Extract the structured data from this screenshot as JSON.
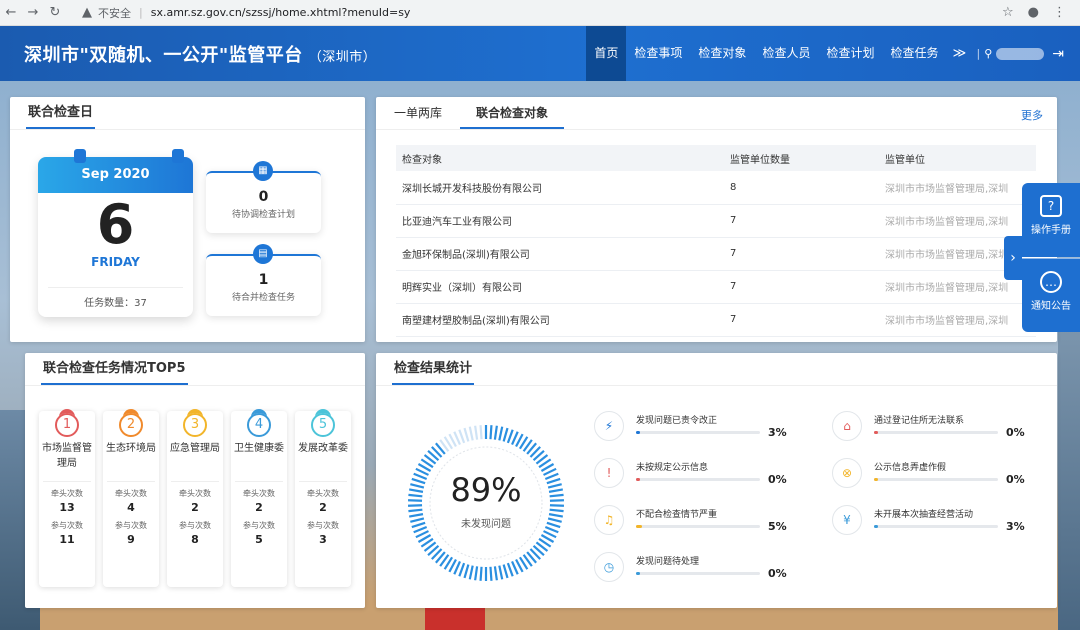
{
  "browser": {
    "insecure": "不安全",
    "url": "sx.amr.sz.gov.cn/szssj/home.xhtml?menuId=sy"
  },
  "header": {
    "title": "深圳市\"双随机、一公开\"监管平台",
    "subtitle": "（深圳市）",
    "nav": [
      "首页",
      "检查事项",
      "检查对象",
      "检查人员",
      "检查计划",
      "检查任务"
    ]
  },
  "calendar": {
    "panel_title": "联合检查日",
    "month": "Sep 2020",
    "day": "6",
    "weekday": "FRIDAY",
    "task_label": "任务数量：",
    "task_count": "37",
    "stats": [
      {
        "value": "0",
        "label": "待协调检查计划"
      },
      {
        "value": "1",
        "label": "待合并检查任务"
      }
    ]
  },
  "objects": {
    "tabs": [
      "一单两库",
      "联合检查对象"
    ],
    "more": "更多",
    "columns": [
      "检查对象",
      "监管单位数量",
      "监管单位"
    ],
    "rows": [
      [
        "深圳长城开发科技股份有限公司",
        "8",
        "深圳市市场监督管理局,深圳"
      ],
      [
        "比亚迪汽车工业有限公司",
        "7",
        "深圳市市场监督管理局,深圳"
      ],
      [
        "金旭环保制品(深圳)有限公司",
        "7",
        "深圳市市场监督管理局,深圳"
      ],
      [
        "明辉实业（深圳）有限公司",
        "7",
        "深圳市市场监督管理局,深圳"
      ],
      [
        "南塑建材塑胶制品(深圳)有限公司",
        "7",
        "深圳市市场监督管理局,深圳"
      ]
    ]
  },
  "top5": {
    "panel_title": "联合检查任务情况TOP5",
    "lead_label": "牵头次数",
    "join_label": "参与次数",
    "items": [
      {
        "rank": "1",
        "name": "市场监督管理局",
        "lead": "13",
        "join": "11",
        "color": "#e25b5b"
      },
      {
        "rank": "2",
        "name": "生态环境局",
        "lead": "4",
        "join": "9",
        "color": "#f08a2c"
      },
      {
        "rank": "3",
        "name": "应急管理局",
        "lead": "2",
        "join": "8",
        "color": "#f2b52a"
      },
      {
        "rank": "4",
        "name": "卫生健康委",
        "lead": "2",
        "join": "5",
        "color": "#3a9ad9"
      },
      {
        "rank": "5",
        "name": "发展改革委",
        "lead": "2",
        "join": "3",
        "color": "#4cc4d9"
      }
    ]
  },
  "results": {
    "panel_title": "检查结果统计",
    "gauge_value": "89%",
    "gauge_label": "未发现问题",
    "gauge_fraction": 0.89,
    "items": [
      {
        "label": "发现问题已责令改正",
        "value": "3%",
        "fraction": 0.03,
        "icon": "lightning-icon",
        "glyph": "⚡",
        "color": "#1e76d6"
      },
      {
        "label": "通过登记住所无法联系",
        "value": "0%",
        "fraction": 0.0,
        "icon": "home-icon",
        "glyph": "⌂",
        "color": "#e25b5b"
      },
      {
        "label": "未按规定公示信息",
        "value": "0%",
        "fraction": 0.0,
        "icon": "alert-icon",
        "glyph": "!",
        "color": "#e25b5b"
      },
      {
        "label": "公示信息弄虚作假",
        "value": "0%",
        "fraction": 0.0,
        "icon": "cancel-icon",
        "glyph": "⊗",
        "color": "#f2b52a"
      },
      {
        "label": "不配合检查情节严重",
        "value": "5%",
        "fraction": 0.05,
        "icon": "bell-icon",
        "glyph": "♫",
        "color": "#f2b52a"
      },
      {
        "label": "未开展本次抽查经营活动",
        "value": "3%",
        "fraction": 0.03,
        "icon": "no-business-icon",
        "glyph": "¥",
        "color": "#3a9ad9"
      },
      {
        "label": "发现问题待处理",
        "value": "0%",
        "fraction": 0.0,
        "icon": "clock-icon",
        "glyph": "◷",
        "color": "#3a9ad9"
      }
    ]
  },
  "side": {
    "manual": "操作手册",
    "notice": "通知公告"
  }
}
